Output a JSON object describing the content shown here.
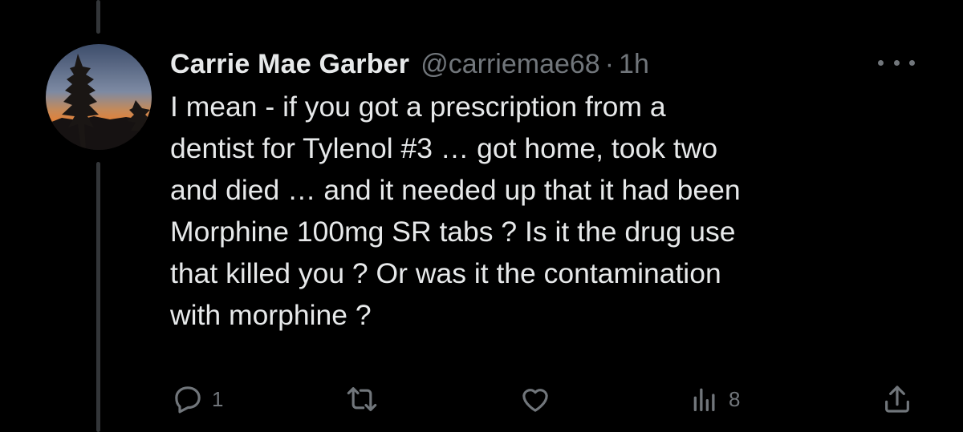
{
  "tweet": {
    "display_name": "Carrie Mae Garber",
    "handle": "@carriemae68",
    "separator": "·",
    "time": "1h",
    "text": "I mean - if you got a prescription from a\ndentist for Tylenol #3 … got home, took two\nand died … and it needed up that it had been\nMorphine 100mg SR tabs ? Is it the drug use\nthat killed you ? Or was it the contamination\nwith morphine ?"
  },
  "actions": {
    "reply_icon": "reply-icon",
    "reply_count": "1",
    "retweet_icon": "retweet-icon",
    "like_icon": "like-icon",
    "views_icon": "views-icon",
    "views_count": "8",
    "share_icon": "share-icon"
  },
  "colors": {
    "background": "#000000",
    "text": "#e7e9ea",
    "muted": "#71767b",
    "thread_line": "#333639"
  }
}
